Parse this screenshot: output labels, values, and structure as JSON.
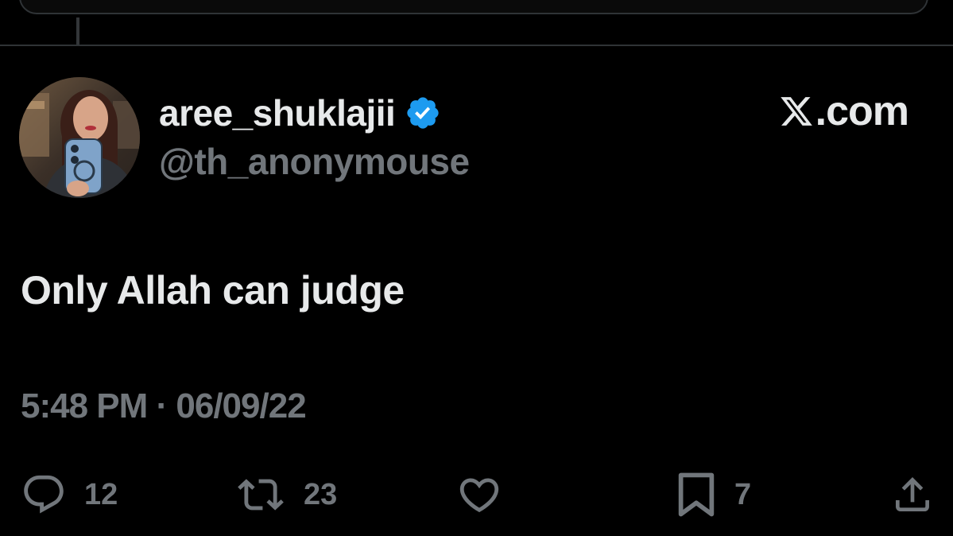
{
  "tweet": {
    "display_name": "aree_shuklajii",
    "handle": "@th_anonymouse",
    "verified": true,
    "text": "Only Allah can judge",
    "timestamp": "5:48 PM · 06/09/22"
  },
  "watermark": {
    "logo": "x-logo-icon",
    "text": ".com"
  },
  "actions": {
    "reply": {
      "icon": "reply-icon",
      "count": "12"
    },
    "retweet": {
      "icon": "retweet-icon",
      "count": "23"
    },
    "like": {
      "icon": "heart-icon",
      "count": ""
    },
    "bookmark": {
      "icon": "bookmark-icon",
      "count": "7"
    },
    "share": {
      "icon": "share-icon",
      "count": ""
    }
  },
  "colors": {
    "background": "#000000",
    "primary_text": "#e7e9ea",
    "secondary_text": "#71767b",
    "verified": "#1d9bf0",
    "divider": "#2f3336"
  }
}
